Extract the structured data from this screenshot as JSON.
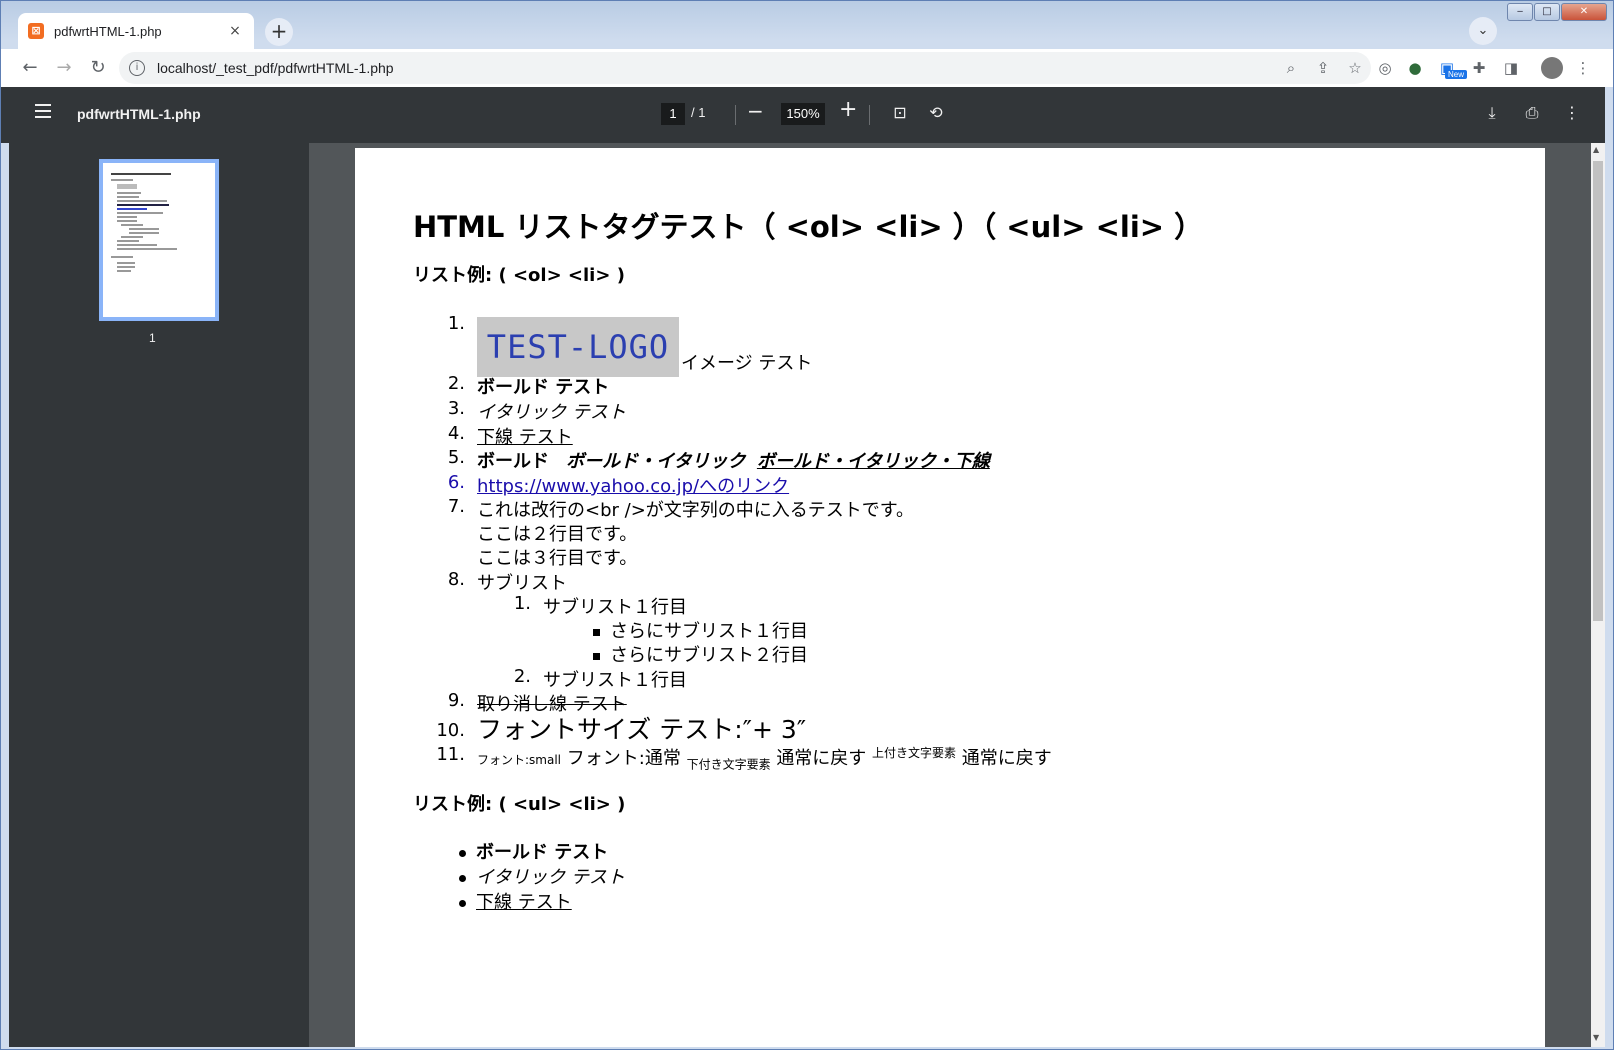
{
  "browser": {
    "tab_title": "pdfwrtHTML-1.php",
    "tab_close": "×",
    "new_tab": "+",
    "tab_search": "⌄",
    "url": "localhost/_test_pdf/pdfwrtHTML-1.php",
    "new_badge": "New"
  },
  "window_controls": {
    "minimize": "‒",
    "maximize": "□",
    "close": "✕"
  },
  "pdf_toolbar": {
    "title": "pdfwrtHTML-1.php",
    "page_current": "1",
    "page_total": "/  1",
    "zoom": "150%",
    "zoom_out": "−",
    "zoom_in": "+"
  },
  "thumbnails": [
    {
      "number": "1"
    }
  ],
  "document": {
    "heading": "HTML リストタグテスト（ <ol> <li> ）（ <ul> <li> ）",
    "ol_section_title": "リスト例: ( <ol> <li> )",
    "ul_section_title": "リスト例: ( <ul> <li> )",
    "ol_items": [
      {
        "num": "1.",
        "logo": "TEST-LOGO",
        "text": "イメージ テスト"
      },
      {
        "num": "2.",
        "text": "ボールド テスト"
      },
      {
        "num": "3.",
        "text": "イタリック テスト"
      },
      {
        "num": "4.",
        "text": "下線 テスト"
      },
      {
        "num": "5.",
        "text_bold": "ボールド",
        "text_bold_italic": "ボールド・イタリック",
        "text_bold_italic_underline": "ボールド・イタリック・下線"
      },
      {
        "num": "6.",
        "link": "https://www.yahoo.co.jp/へのリンク"
      },
      {
        "num": "7.",
        "lines": [
          "これは改行の<br />が文字列の中に入るテストです。",
          "ここは２行目です。",
          "ここは３行目です。"
        ]
      },
      {
        "num": "8.",
        "text": "サブリスト",
        "sub": [
          {
            "num": "1.",
            "text": "サブリスト１行目"
          },
          {
            "num": "2.",
            "text": "サブリスト１行目"
          }
        ],
        "subsub": [
          "さらにサブリスト１行目",
          "さらにサブリスト２行目"
        ]
      },
      {
        "num": "9.",
        "text": "取り消し線 テスト"
      },
      {
        "num": "10.",
        "text": "フォントサイズ テスト:″+ 3″"
      },
      {
        "num": "11.",
        "small": "フォント:small",
        "normal": "フォント:通常",
        "sub": "下付き文字要素",
        "back1": "通常に戻す",
        "sup": "上付き文字要素",
        "back2": "通常に戻す"
      }
    ],
    "ul_items": [
      "ボールド テスト",
      "イタリック テスト",
      "下線 テスト"
    ]
  }
}
